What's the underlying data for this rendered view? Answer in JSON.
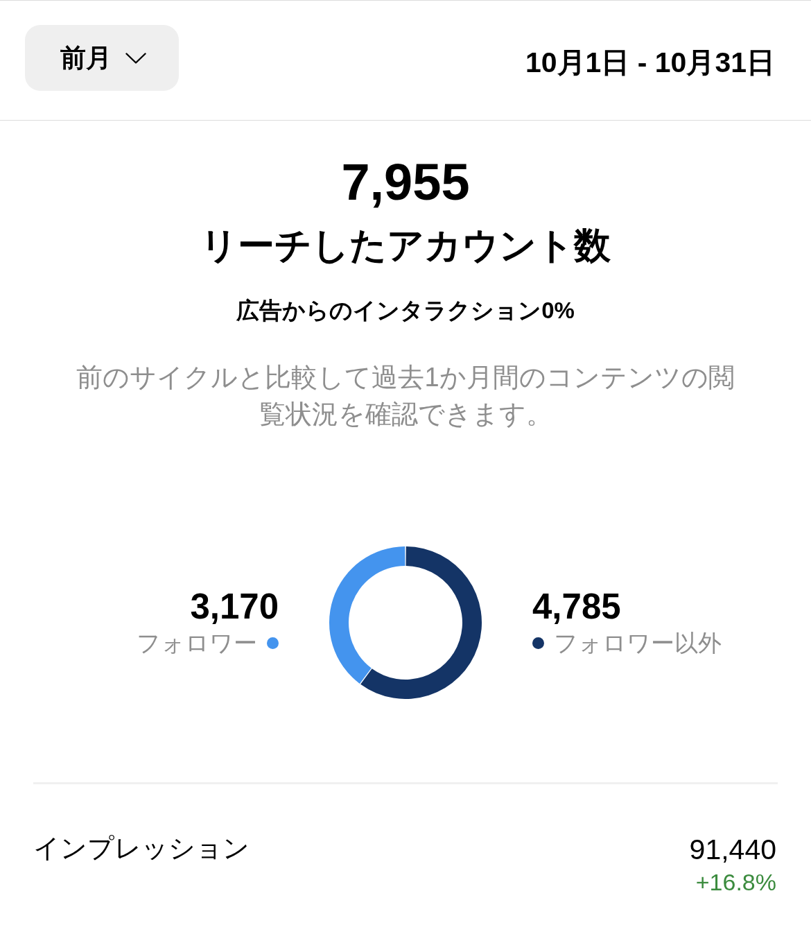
{
  "header": {
    "period_button": {
      "label": "前月"
    },
    "date_range": "10月1日 - 10月31日"
  },
  "summary": {
    "total": "7,955",
    "title": "リーチしたアカウント数",
    "ad_interaction": "広告からのインタラクション0%",
    "description": "前のサイクルと比較して過去1か月間のコンテンツの閲覧状況を確認できます。"
  },
  "breakdown": {
    "chart_data": {
      "type": "donut",
      "categories": [
        "フォロワー",
        "フォロワー以外"
      ],
      "values": [
        39.85,
        60.15
      ]
    },
    "legend": [
      {
        "value": "3,170",
        "color": "#4494ee"
      },
      {
        "value": "4,785",
        "color": "#143466"
      }
    ]
  },
  "metrics": [
    {
      "label": "インプレッション",
      "value": "91,440",
      "change": "+16.8%",
      "positive": true
    }
  ]
}
